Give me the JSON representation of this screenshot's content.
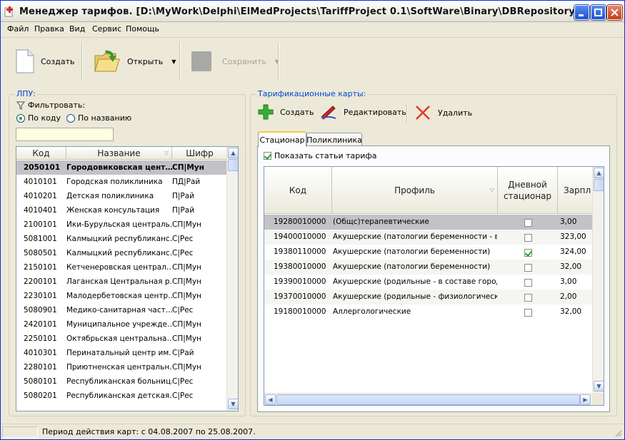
{
  "window": {
    "title": "Менеджер тарифов. [D:\\MyWork\\Delphi\\ElMedProjects\\TariffProject 0.1\\SoftWare\\Binary\\DBRepository]"
  },
  "menu": [
    "Файл",
    "Правка",
    "Вид",
    "Сервис",
    "Помощь"
  ],
  "toolbar": {
    "create": "Создать",
    "open": "Открыть",
    "save": "Сохранить"
  },
  "lpu": {
    "group_title": "ЛПУ:",
    "filter_label": "Фильтровать:",
    "by_code": "По коду",
    "by_name": "По названию",
    "filter_value": "",
    "columns": [
      "Код",
      "Название",
      "Шифр"
    ],
    "rows": [
      {
        "code": "2050101",
        "name": "Городовиковская цент…",
        "cipher": "СП|Мун"
      },
      {
        "code": "4010101",
        "name": "Городская поликлиника",
        "cipher": "ПД|Рай"
      },
      {
        "code": "4010201",
        "name": "Детская поликлиника",
        "cipher": "П|Рай"
      },
      {
        "code": "4010401",
        "name": "Женская консультация",
        "cipher": "П|Рай"
      },
      {
        "code": "2100101",
        "name": "Ики-Бурульская централь…",
        "cipher": "СП|Мун"
      },
      {
        "code": "5081001",
        "name": "Калмыцкий республиканс…",
        "cipher": "С|Рес"
      },
      {
        "code": "5080501",
        "name": "Калмыцкий республиканс…",
        "cipher": "С|Рес"
      },
      {
        "code": "2150101",
        "name": "Кетченеровская централ…",
        "cipher": "СП|Мун"
      },
      {
        "code": "2200101",
        "name": "Лаганская Центральная р…",
        "cipher": "СП|Мун"
      },
      {
        "code": "2230101",
        "name": "Малодербетовская центр…",
        "cipher": "СП|Мун"
      },
      {
        "code": "5080901",
        "name": "Медико-санитарная част…",
        "cipher": "С|Рес"
      },
      {
        "code": "2420101",
        "name": "Муниципальное учрежде…",
        "cipher": "СП|Мун"
      },
      {
        "code": "2250101",
        "name": "Октябрьская центральна…",
        "cipher": "СП|Мун"
      },
      {
        "code": "4010301",
        "name": "Перинатальный центр им…",
        "cipher": "С|Рай"
      },
      {
        "code": "2280101",
        "name": "Приютненская центральн…",
        "cipher": "СП|Мун"
      },
      {
        "code": "5080101",
        "name": "Республиканская больниц…",
        "cipher": "С|Рес"
      },
      {
        "code": "5080201",
        "name": "Республиканская детская…",
        "cipher": "С|Рес"
      }
    ]
  },
  "cards": {
    "group_title": "Тарификационные карты:",
    "create": "Создать",
    "edit": "Редактировать",
    "delete": "Удалить",
    "tabs": [
      "Стационар",
      "Поликлиника"
    ],
    "show_items_label": "Показать статьи тарифа",
    "columns": [
      "Код",
      "Профиль",
      "Дневной стационар",
      "Зарпл"
    ],
    "rows": [
      {
        "code": "19280010000",
        "profile": "(Общс)терапевтические",
        "day": false,
        "val": "3,00"
      },
      {
        "code": "19400010000",
        "profile": "Акушерские (патологии беременности - в …",
        "day": false,
        "val": "323,00"
      },
      {
        "code": "19380110000",
        "profile": "Акушерские (патологии беременности)",
        "day": true,
        "val": "324,00"
      },
      {
        "code": "19380010000",
        "profile": "Акушерские (патологии беременности)",
        "day": false,
        "val": "32,00"
      },
      {
        "code": "19390010000",
        "profile": "Акушерские (родильные - в составе город…",
        "day": false,
        "val": "3,00"
      },
      {
        "code": "19370010000",
        "profile": "Акушерские (родильные - физиологическ…",
        "day": false,
        "val": "2,00"
      },
      {
        "code": "19180010000",
        "profile": "Аллергологические",
        "day": false,
        "val": "32,00"
      }
    ]
  },
  "status": {
    "text": "Период действия карт: с 04.08.2007 по 25.08.2007."
  }
}
